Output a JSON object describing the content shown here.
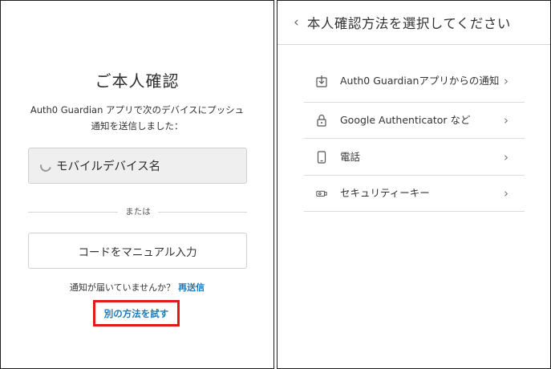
{
  "left": {
    "title": "ご本人確認",
    "description_line1": "Auth0 Guardian アプリで次のデバイスにプッシュ",
    "description_line2": "通知を送信しました：",
    "device_name": "モバイルデバイス名",
    "divider_text": "または",
    "manual_button": "コードをマニュアル入力",
    "not_received_text": "通知が届いていませんか？",
    "resend_link": "再送信",
    "try_other_link": "別の方法を試す"
  },
  "right": {
    "back_glyph": "‹",
    "title": "本人確認方法を選択してください",
    "methods": [
      {
        "label": "Auth0 Guardianアプリからの通知",
        "icon": "download-icon"
      },
      {
        "label": "Google Authenticator など",
        "icon": "lock-icon"
      },
      {
        "label": "電話",
        "icon": "phone-icon"
      },
      {
        "label": "セキュリティーキー",
        "icon": "security-key-icon"
      }
    ],
    "chevron_glyph": "›"
  },
  "colors": {
    "link": "#1f7ab8",
    "highlight_border": "#e0191d",
    "device_box_bg": "#efefef"
  }
}
